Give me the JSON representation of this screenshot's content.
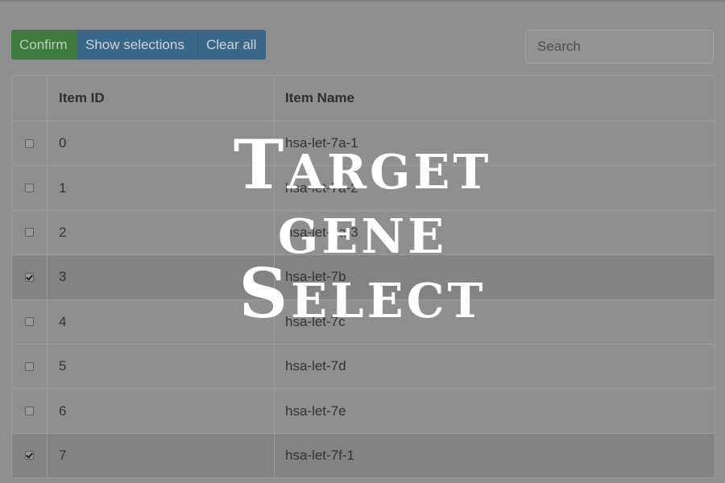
{
  "toolbar": {
    "confirm_label": "Confirm",
    "show_selections_label": "Show selections",
    "clear_all_label": "Clear all",
    "colors": {
      "confirm": "#3f7a3f",
      "primary": "#3a6687"
    }
  },
  "search": {
    "placeholder": "Search"
  },
  "table": {
    "headers": [
      "Item ID",
      "Item Name"
    ],
    "rows": [
      {
        "id": "0",
        "name": "hsa-let-7a-1",
        "checked": false
      },
      {
        "id": "1",
        "name": "hsa-let-7a-2",
        "checked": false
      },
      {
        "id": "2",
        "name": "hsa-let-7a-3",
        "checked": false
      },
      {
        "id": "3",
        "name": "hsa-let-7b",
        "checked": true
      },
      {
        "id": "4",
        "name": "hsa-let-7c",
        "checked": false
      },
      {
        "id": "5",
        "name": "hsa-let-7d",
        "checked": false
      },
      {
        "id": "6",
        "name": "hsa-let-7e",
        "checked": false
      },
      {
        "id": "7",
        "name": "hsa-let-7f-1",
        "checked": true
      }
    ]
  },
  "overlay": {
    "line1": "Target",
    "line2": "gene",
    "line3": "Select"
  }
}
